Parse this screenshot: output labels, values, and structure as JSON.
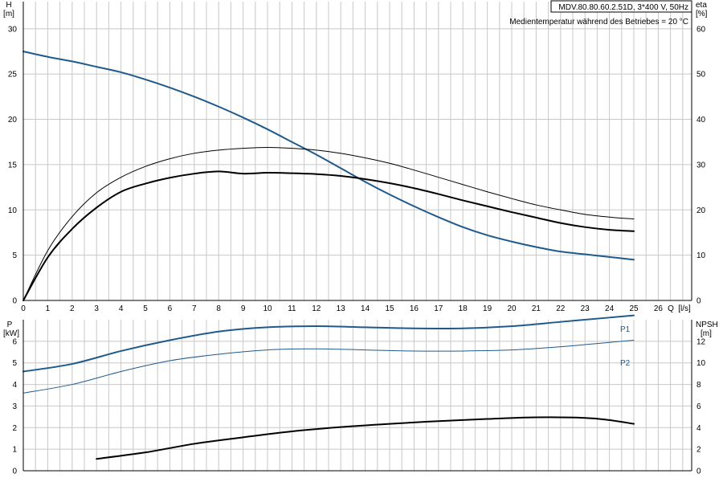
{
  "header": {
    "model": "MDV.80.80.60.2.51D, 3*400 V, 50Hz",
    "medium": "Medientemperatur während des Betriebes = 20 °C"
  },
  "colors": {
    "grid": "#c8c8c8",
    "blue": "#1f5a8c",
    "black": "#000000"
  },
  "chart_data": [
    {
      "type": "line",
      "grid": true,
      "x_label": "Q [l/s]",
      "x_label_q": "Q",
      "x_label_unit": "[l/s]",
      "xlim": [
        0,
        27
      ],
      "x_ticks": [
        0,
        1,
        2,
        3,
        4,
        5,
        6,
        7,
        8,
        9,
        10,
        11,
        12,
        13,
        14,
        15,
        16,
        17,
        18,
        19,
        20,
        21,
        22,
        23,
        24,
        25,
        26
      ],
      "y_left": {
        "label": "H",
        "unit": "[m]",
        "lim": [
          0,
          33
        ],
        "ticks": [
          0,
          5,
          10,
          15,
          20,
          25,
          30
        ]
      },
      "y_right": {
        "label": "eta",
        "unit": "[%]",
        "lim": [
          0,
          66
        ],
        "ticks": [
          0,
          10,
          20,
          30,
          40,
          50,
          60
        ]
      },
      "series": [
        {
          "axis": "left",
          "color": "#1f5a8c",
          "width": 2,
          "x": [
            0,
            1,
            2,
            3,
            4,
            5,
            6,
            7,
            8,
            9,
            10,
            11,
            12,
            13,
            14,
            15,
            16,
            17,
            18,
            19,
            20,
            21,
            22,
            23,
            24,
            25
          ],
          "y": [
            27.5,
            26.9,
            26.4,
            25.8,
            25.2,
            24.4,
            23.5,
            22.5,
            21.4,
            20.2,
            18.9,
            17.5,
            16.1,
            14.6,
            13.1,
            11.7,
            10.4,
            9.2,
            8.1,
            7.2,
            6.5,
            5.9,
            5.4,
            5.1,
            4.8,
            4.5
          ]
        },
        {
          "axis": "right",
          "color": "#000000",
          "width": 1,
          "x": [
            0,
            1,
            2,
            3,
            4,
            5,
            6,
            7,
            8,
            9,
            10,
            11,
            12,
            13,
            14,
            15,
            16,
            17,
            18,
            19,
            20,
            21,
            22,
            23,
            24,
            25
          ],
          "y": [
            0,
            11,
            18.5,
            23.8,
            27.2,
            29.6,
            31.3,
            32.5,
            33.2,
            33.6,
            33.8,
            33.6,
            33.2,
            32.5,
            31.5,
            30.3,
            28.8,
            27.2,
            25.6,
            24,
            22.5,
            21.1,
            20,
            19,
            18.4,
            18
          ]
        },
        {
          "axis": "right",
          "color": "#000000",
          "width": 2,
          "x": [
            0,
            1,
            2,
            3,
            4,
            5,
            6,
            7,
            8,
            9,
            10,
            11,
            12,
            13,
            14,
            15,
            16,
            17,
            18,
            19,
            20,
            21,
            22,
            23,
            24,
            25
          ],
          "y": [
            0,
            9.5,
            15.8,
            20.5,
            24,
            25.8,
            27.1,
            28,
            28.5,
            28,
            28.2,
            28.1,
            27.9,
            27.5,
            26.8,
            25.9,
            24.8,
            23.5,
            22.1,
            20.8,
            19.5,
            18.3,
            17.1,
            16.2,
            15.6,
            15.3
          ]
        }
      ]
    },
    {
      "type": "line",
      "grid": true,
      "xlim": [
        0,
        27
      ],
      "y_left": {
        "label": "P",
        "unit": "[kW]",
        "lim": [
          0,
          7
        ],
        "ticks": [
          0,
          1,
          2,
          3,
          4,
          5,
          6
        ]
      },
      "y_right": {
        "label": "NPSH",
        "unit": "[m]",
        "lim": [
          0,
          14
        ],
        "ticks": [
          0,
          2,
          4,
          6,
          8,
          10,
          12
        ]
      },
      "series": [
        {
          "name": "P1",
          "axis": "left",
          "color": "#1f5a8c",
          "width": 2,
          "x": [
            0,
            2,
            4,
            6,
            8,
            10,
            12,
            14,
            16,
            18,
            20,
            22,
            24,
            25
          ],
          "y": [
            4.6,
            4.95,
            5.55,
            6.05,
            6.45,
            6.65,
            6.7,
            6.65,
            6.6,
            6.6,
            6.7,
            6.9,
            7.1,
            7.2
          ]
        },
        {
          "name": "P2",
          "axis": "left",
          "color": "#1f5a8c",
          "width": 1,
          "x": [
            0,
            2,
            4,
            6,
            8,
            10,
            12,
            14,
            16,
            18,
            20,
            22,
            24,
            25
          ],
          "y": [
            3.6,
            4.0,
            4.6,
            5.1,
            5.4,
            5.6,
            5.65,
            5.6,
            5.55,
            5.55,
            5.6,
            5.75,
            5.95,
            6.05
          ]
        },
        {
          "axis": "right",
          "color": "#000000",
          "width": 2,
          "x": [
            3,
            5,
            7,
            9,
            11,
            13,
            15,
            17,
            19,
            21,
            23,
            24,
            25
          ],
          "y": [
            1.1,
            1.7,
            2.5,
            3.1,
            3.65,
            4.05,
            4.35,
            4.6,
            4.8,
            4.95,
            4.9,
            4.7,
            4.35
          ]
        }
      ]
    }
  ]
}
